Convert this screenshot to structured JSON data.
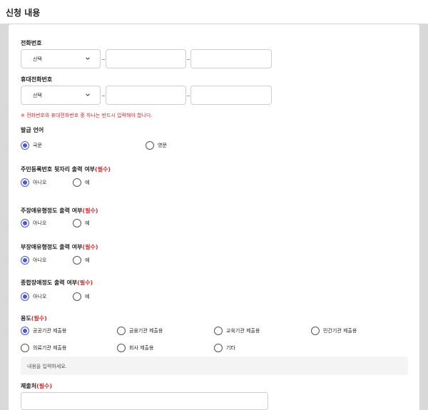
{
  "section": {
    "title": "신청 내용"
  },
  "phone": {
    "label": "전화번호",
    "select_value": "선택",
    "dash": "-"
  },
  "mobile": {
    "label": "휴대전화번호",
    "select_value": "선택"
  },
  "note": "※ 전화번호와 휴대전화번호 중 하나는 반드시 입력해야 합니다.",
  "language": {
    "label": "발급 언어",
    "options": [
      "국문",
      "영문"
    ],
    "selected": "국문"
  },
  "q_rrn": {
    "label": "주민등록번호 뒷자리 출력 여부",
    "req": "(필수)"
  },
  "q_main": {
    "label": "주장애유형정도 출력 여부",
    "req": "(필수)"
  },
  "q_sub": {
    "label": "부장애유형정도 출력 여부",
    "req": "(필수)"
  },
  "q_total": {
    "label": "종합장애정도 출력 여부",
    "req": "(필수)"
  },
  "yesno": {
    "no": "아니오",
    "yes": "예",
    "selected": "아니오"
  },
  "purpose": {
    "label": "용도",
    "req": "(필수)",
    "options": [
      "공공기관 제출용",
      "금융기관 제출용",
      "교육기관 제출용",
      "민간기관 제출용",
      "의료기관 제출용",
      "회사 제출용",
      "기타"
    ],
    "selected": "공공기관 제출용",
    "textarea_placeholder": "내용을 입력하세요."
  },
  "submitto": {
    "label": "제출처",
    "req": "(필수)"
  },
  "colors": {
    "accent": "#4a57d6",
    "required": "#d32b2b"
  }
}
